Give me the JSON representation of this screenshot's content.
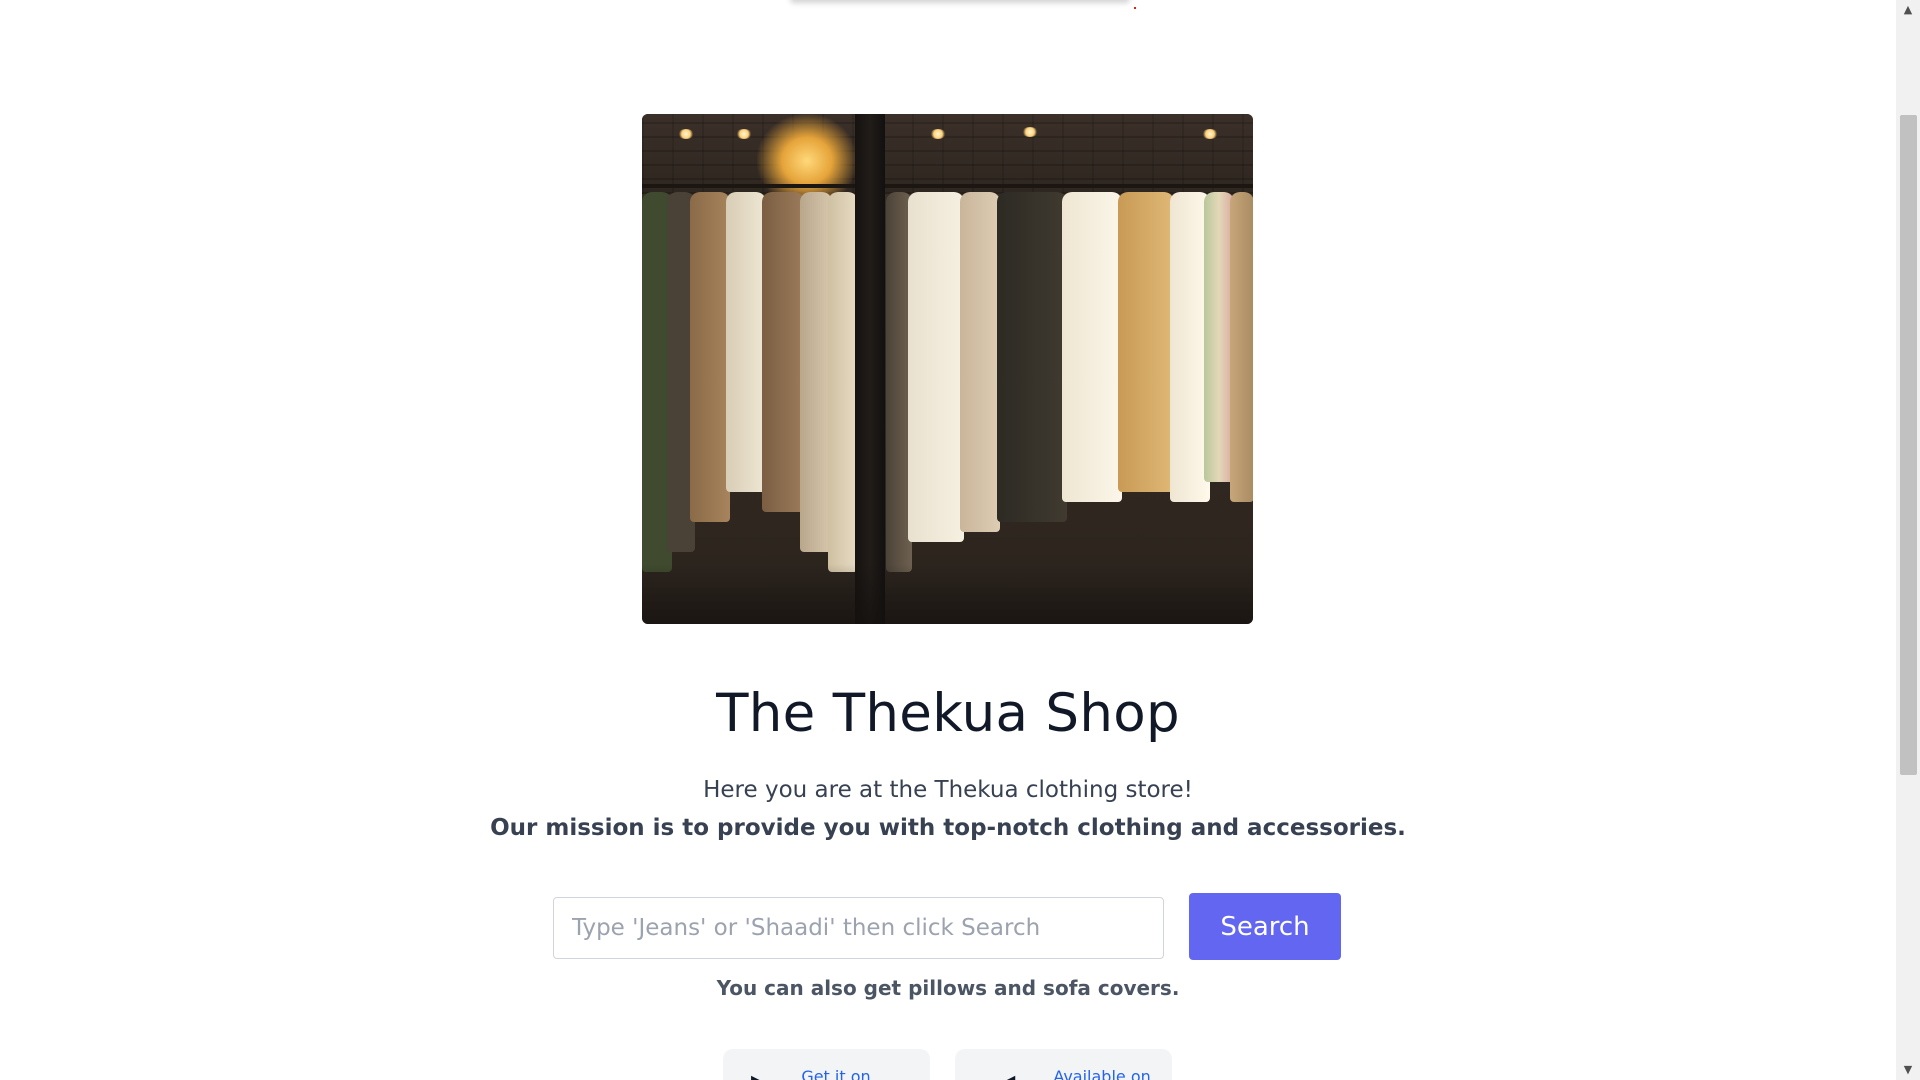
{
  "hero": {
    "image_alt": "Clothing rack with hanging garments in a store window"
  },
  "shop": {
    "title": "The Thekua Shop",
    "subtitle": "Here you are at the Thekua clothing store!",
    "mission": "Our mission is to provide you with top-notch clothing and accessories."
  },
  "search": {
    "placeholder": "Type 'Jeans' or 'Shaadi' then click Search",
    "value": "",
    "button_label": "Search",
    "note": "You can also get pillows and sofa covers."
  },
  "badges": [
    {
      "icon": "play-store-icon",
      "label": "Get it on"
    },
    {
      "icon": "apple-icon",
      "label": "Available on"
    }
  ],
  "colors": {
    "accent": "#6366f1",
    "title": "#111827",
    "text": "#374151",
    "link": "#2563eb"
  }
}
